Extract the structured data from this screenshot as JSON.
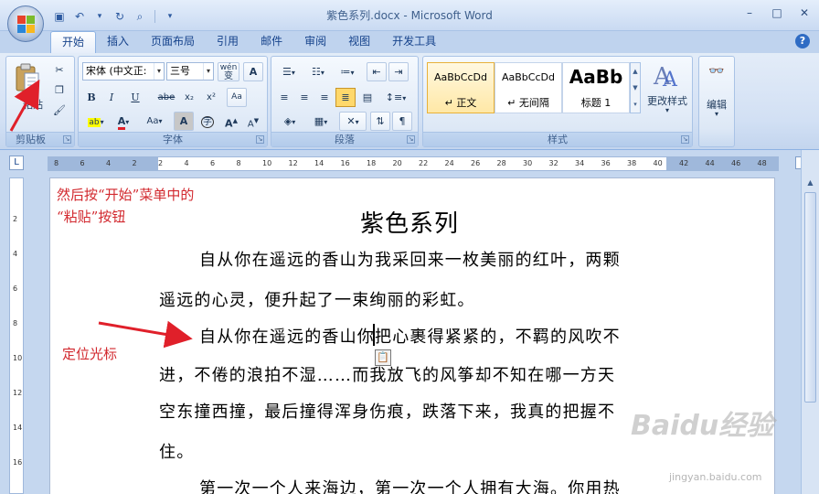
{
  "window": {
    "title": "紫色系列.docx - Microsoft Word",
    "qat": [
      "save-icon",
      "undo-icon",
      "redo-icon",
      "print-preview-icon"
    ],
    "controls": {
      "minimize": "–",
      "restore": "□",
      "close": "✕"
    }
  },
  "tabs": [
    {
      "label": "开始",
      "active": true
    },
    {
      "label": "插入"
    },
    {
      "label": "页面布局"
    },
    {
      "label": "引用"
    },
    {
      "label": "邮件"
    },
    {
      "label": "审阅"
    },
    {
      "label": "视图"
    },
    {
      "label": "开发工具"
    }
  ],
  "ribbon": {
    "clipboard": {
      "label": "剪贴板",
      "paste_label": "粘贴"
    },
    "font": {
      "label": "字体",
      "font_name": "宋体 (中文正:",
      "font_size": "三号",
      "wen": "wén",
      "A_box": "A",
      "bold": "B",
      "italic": "I",
      "underline": "U",
      "strike": "abe",
      "sub": "x₂",
      "sup": "x²",
      "grow": "A",
      "shrink": "A",
      "change_case": "Aa",
      "char_shade": "A",
      "enclose": "字"
    },
    "paragraph": {
      "label": "段落"
    },
    "styles": {
      "label": "样式",
      "items": [
        {
          "sample": "AaBbCcDd",
          "name": "↵ 正文",
          "selected": true
        },
        {
          "sample": "AaBbCcDd",
          "name": "↵ 无间隔"
        },
        {
          "sample": "AaBb",
          "name": "标题 1"
        }
      ],
      "change_styles": "更改样式"
    },
    "editing": {
      "label": "编辑"
    }
  },
  "ruler": {
    "h_ticks": [
      "8",
      "6",
      "4",
      "2",
      "2",
      "4",
      "6",
      "8",
      "10",
      "12",
      "14",
      "16",
      "18",
      "20",
      "22",
      "24",
      "26",
      "28",
      "30",
      "32",
      "34",
      "36",
      "38",
      "40",
      "42",
      "44",
      "46",
      "48"
    ],
    "corner": "L"
  },
  "document": {
    "title": "紫色系列",
    "lines": [
      "自从你在遥远的香山为我采回来一枚美丽的红叶，两颗",
      "遥远的心灵，便升起了一束绚丽的彩虹。",
      "自从你在遥远的香山你把心裹得紧紧的，不羁的风吹不",
      "进，不倦的浪拍不湿……而我放飞的风筝却不知在哪一方天",
      "空东撞西撞，最后撞得浑身伤痕，跌落下来，我真的把握不",
      "住。",
      "第一次一个人来海边，第一次一个人拥有大海。你用热"
    ]
  },
  "annotations": {
    "top": "然后按“开始”菜单中的",
    "top2": "“粘贴”按钮",
    "cursor": "定位光标"
  },
  "watermark": {
    "brand": "Baidu经验",
    "url": "jingyan.baidu.com"
  },
  "colors": {
    "accent": "#15428b",
    "annotation": "#d2282e",
    "arrow": "#e0202a"
  }
}
